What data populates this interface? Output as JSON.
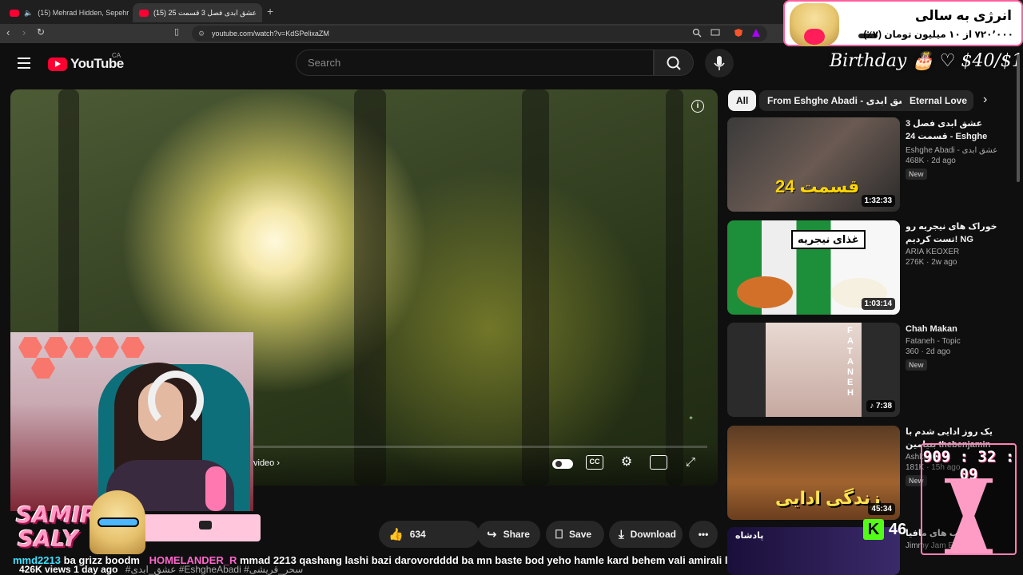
{
  "browser": {
    "tabs": [
      {
        "title": "(15) Mehrad Hidden, Sepehr Khalse",
        "active": false
      },
      {
        "title": "(15) عشق ابدی فصل 3 قسمت 25",
        "active": true
      }
    ],
    "url": "youtube.com/watch?v=KdSPelixaZM"
  },
  "youtube": {
    "logo": "YouTube",
    "region": "CA",
    "search_placeholder": "Search"
  },
  "overlay": {
    "birthday_text": "Birthday 🎂 ♡ $40/$1",
    "donation_title": "انرژی به سالی",
    "donation_progress": "۷۲۰٬۰۰۰ از ۱۰ میلیون تومان (۷٪)",
    "timer": "909 : 32 : 09",
    "kick_count": "46",
    "streamer_name_1": "SAMIRA",
    "streamer_name_2": "SALY"
  },
  "player": {
    "next_label": "video",
    "progress": 0.0
  },
  "actions": {
    "likes": "634",
    "share": "Share",
    "save": "Save",
    "download": "Download"
  },
  "video_meta": {
    "views": "426K views",
    "age": "1 day ago",
    "tags": "#عشق_ابدی #EshgheAbadi #سحر_قریشی"
  },
  "chat": {
    "user1": "mmd2213",
    "msg1": "ba grizz boodm",
    "user2": "HOMELANDER_R",
    "msg2": "mmad 2213 qashang lashi bazi darovordddd ba mn baste bod yeho hamle kard behem vali amirali lehesh kard"
  },
  "chips": [
    "All",
    "From Eshghe Abadi - عشق ابدی",
    "Eternal Love"
  ],
  "recommendations": [
    {
      "title": "عشق ابدی فصل 3 قسمت 24 - Eshghe Abadi",
      "channel": "Eshghe Abadi - عشق ابدی",
      "meta": "468K · 2d ago",
      "duration": "1:32:33",
      "badge": "New",
      "thumb_text": "قسمت 24"
    },
    {
      "title": "خوراک های نیجریه رو تست کردیم! NG",
      "channel": "ARIA KEOXER",
      "meta": "276K · 2w ago",
      "duration": "1:03:14",
      "badge": "",
      "thumb_text": "غذای نیجریه"
    },
    {
      "title": "Chah Makan",
      "channel": "Fataneh - Topic",
      "meta": "360 · 2d ago",
      "duration": "7:38",
      "badge": "New",
      "thumb_text": "FATANEH"
    },
    {
      "title": "یک روز ادایی شدم با بنیامین thebenjamin",
      "channel": "Ashkan",
      "meta": "181K · 15h ago",
      "duration": "45:34",
      "badge": "New",
      "thumb_text": "زندگی ادایی"
    },
    {
      "title": "شب های مافیا",
      "channel": "Jimmy Jam EP 26",
      "meta": "",
      "duration": "",
      "badge": "",
      "thumb_text": "پادشاه"
    }
  ],
  "colors": {
    "accent": "#ff0033",
    "bg": "#0f0f0f",
    "pink": "#ff7fb3",
    "kick": "#53fc18"
  }
}
